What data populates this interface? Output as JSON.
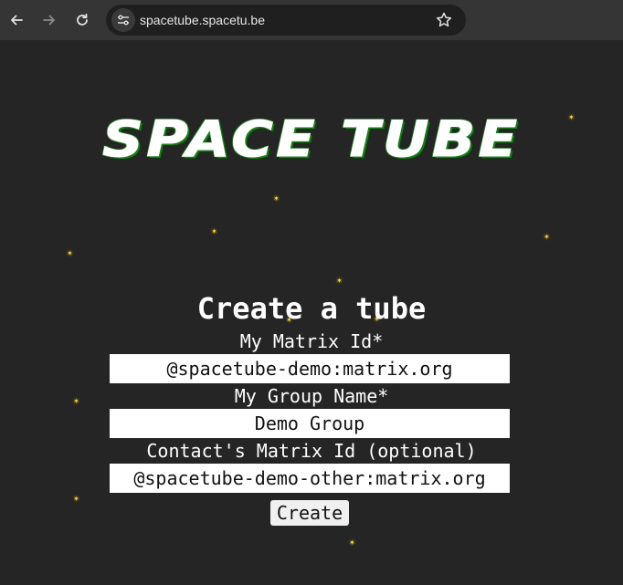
{
  "browser": {
    "url": "spacetube.spacetu.be"
  },
  "logo": {
    "text": "SPACE TUBE"
  },
  "form": {
    "title": "Create a tube",
    "fields": [
      {
        "label": "My Matrix Id*",
        "value": "@spacetube-demo:matrix.org"
      },
      {
        "label": "My Group Name*",
        "value": "Demo Group"
      },
      {
        "label": "Contact's Matrix Id (optional)",
        "value": "@spacetube-demo-other:matrix.org"
      }
    ],
    "submit_label": "Create"
  },
  "colors": {
    "page_background": "#252525",
    "star": "#ffe14a",
    "logo_outline": "#2a8f2a"
  }
}
